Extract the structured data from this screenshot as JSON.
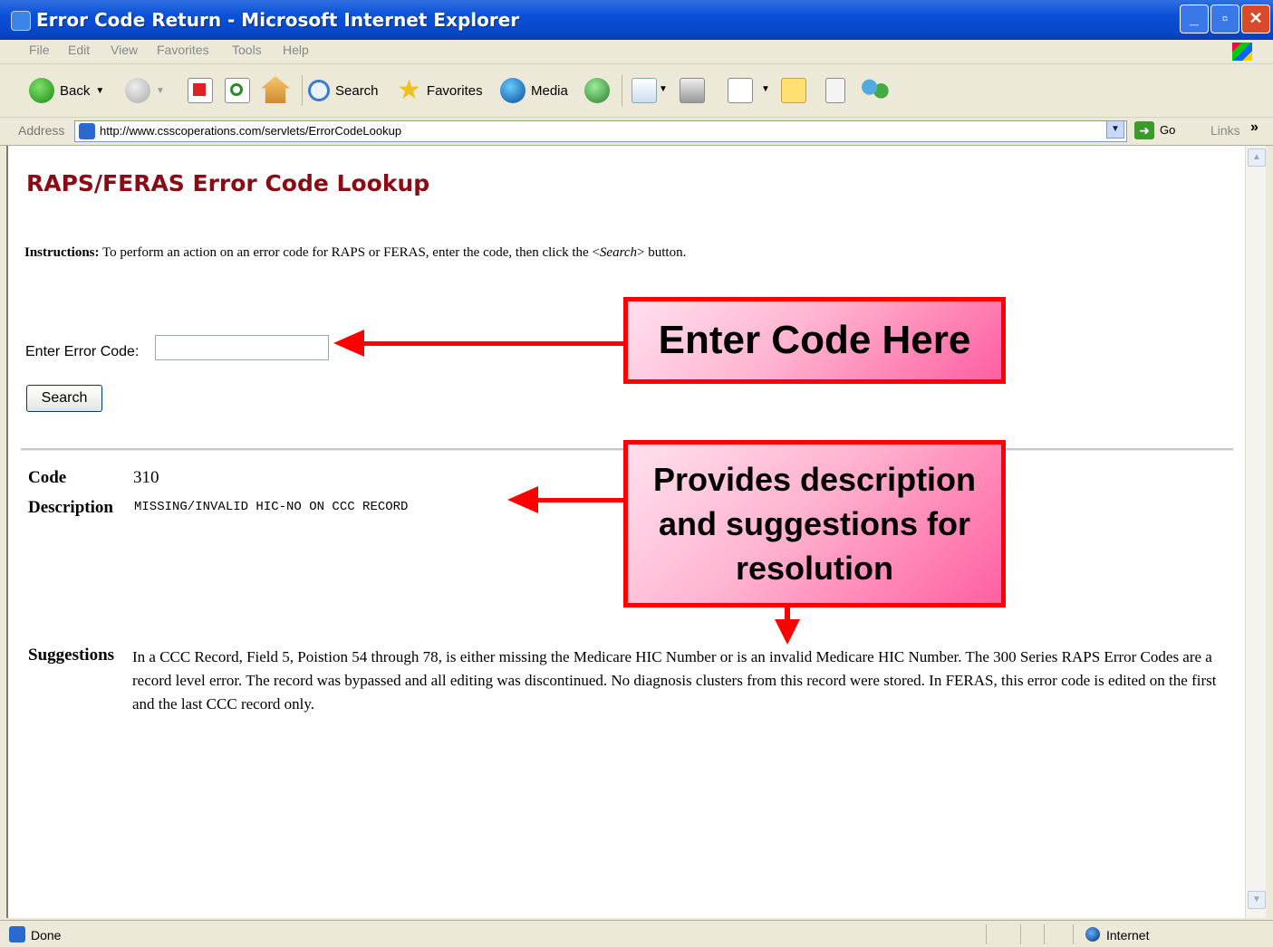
{
  "window": {
    "title": "Error Code Return - Microsoft Internet Explorer",
    "controls": {
      "minimize": "_",
      "maximize": "▫",
      "close": "✕"
    }
  },
  "menu": [
    "File",
    "Edit",
    "View",
    "Favorites",
    "Tools",
    "Help"
  ],
  "toolbar": {
    "back": "Back",
    "search": "Search",
    "favorites": "Favorites",
    "media": "Media"
  },
  "address": {
    "label": "Address",
    "url": "http://www.csscoperations.com/servlets/ErrorCodeLookup",
    "go": "Go",
    "links": "Links",
    "chevron": "»"
  },
  "page": {
    "heading": "RAPS/FERAS Error Code Lookup",
    "instructions": {
      "label": "Instructions:",
      "text_before": " To perform an action on an error code for RAPS or FERAS, enter the code, then click the <",
      "emphasis": "Search",
      "text_after": "> button."
    },
    "error_code_label": "Enter Error Code:",
    "error_code_value": "",
    "search_button": "Search",
    "result": {
      "code_label": "Code",
      "code_value": "310",
      "description_label": "Description",
      "description_value": "MISSING/INVALID HIC-NO ON CCC RECORD",
      "suggestions_label": "Suggestions",
      "suggestions_value": "In a CCC Record, Field 5, Poistion 54 through 78, is either missing the Medicare HIC Number or is an invalid Medicare HIC Number. The 300 Series RAPS Error Codes are a record level error. The record was bypassed and all editing was discontinued. No diagnosis clusters from this record were stored. In FERAS, this error code is edited on the first and the last CCC record only."
    }
  },
  "callouts": {
    "enter_code": "Enter Code Here",
    "description": "Provides description and suggestions for resolution"
  },
  "status": {
    "text": "Done",
    "zone": "Internet"
  },
  "colors": {
    "heading": "#8b0a14",
    "callout_border": "#ff0000",
    "callout_fill": "#ff9cc4",
    "titlebar": "#0a50d8"
  }
}
